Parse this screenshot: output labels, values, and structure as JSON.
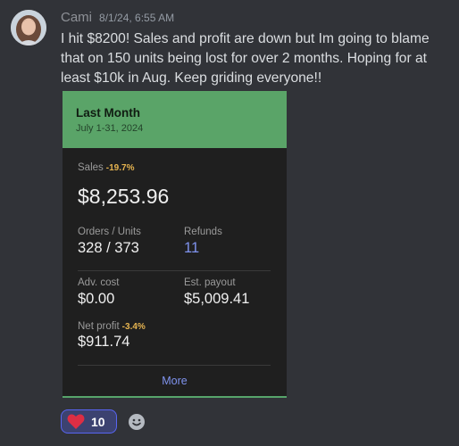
{
  "message": {
    "username": "Cami",
    "timestamp": "8/1/24, 6:55 AM",
    "text": "I hit $8200! Sales and profit are down but Im going to blame that on 150 units being lost for over 2 months. Hoping for at least $10k in Aug. Keep griding everyone!!"
  },
  "card": {
    "title": "Last Month",
    "subtitle": "July 1-31, 2024",
    "sales": {
      "label": "Sales",
      "change": "-19.7%",
      "value": "$8,253.96"
    },
    "orders": {
      "label": "Orders / Units",
      "value": "328 / 373"
    },
    "refunds": {
      "label": "Refunds",
      "value": "11"
    },
    "adv_cost": {
      "label": "Adv. cost",
      "value": "$0.00"
    },
    "est_payout": {
      "label": "Est. payout",
      "value": "$5,009.41"
    },
    "net_profit": {
      "label": "Net profit",
      "change": "-3.4%",
      "value": "$911.74"
    },
    "more_label": "More",
    "header_color": "#5aa468"
  },
  "reactions": [
    {
      "icon": "heart-icon",
      "count": "10"
    }
  ],
  "icons": {
    "add_reaction": "smiley-face-icon"
  }
}
